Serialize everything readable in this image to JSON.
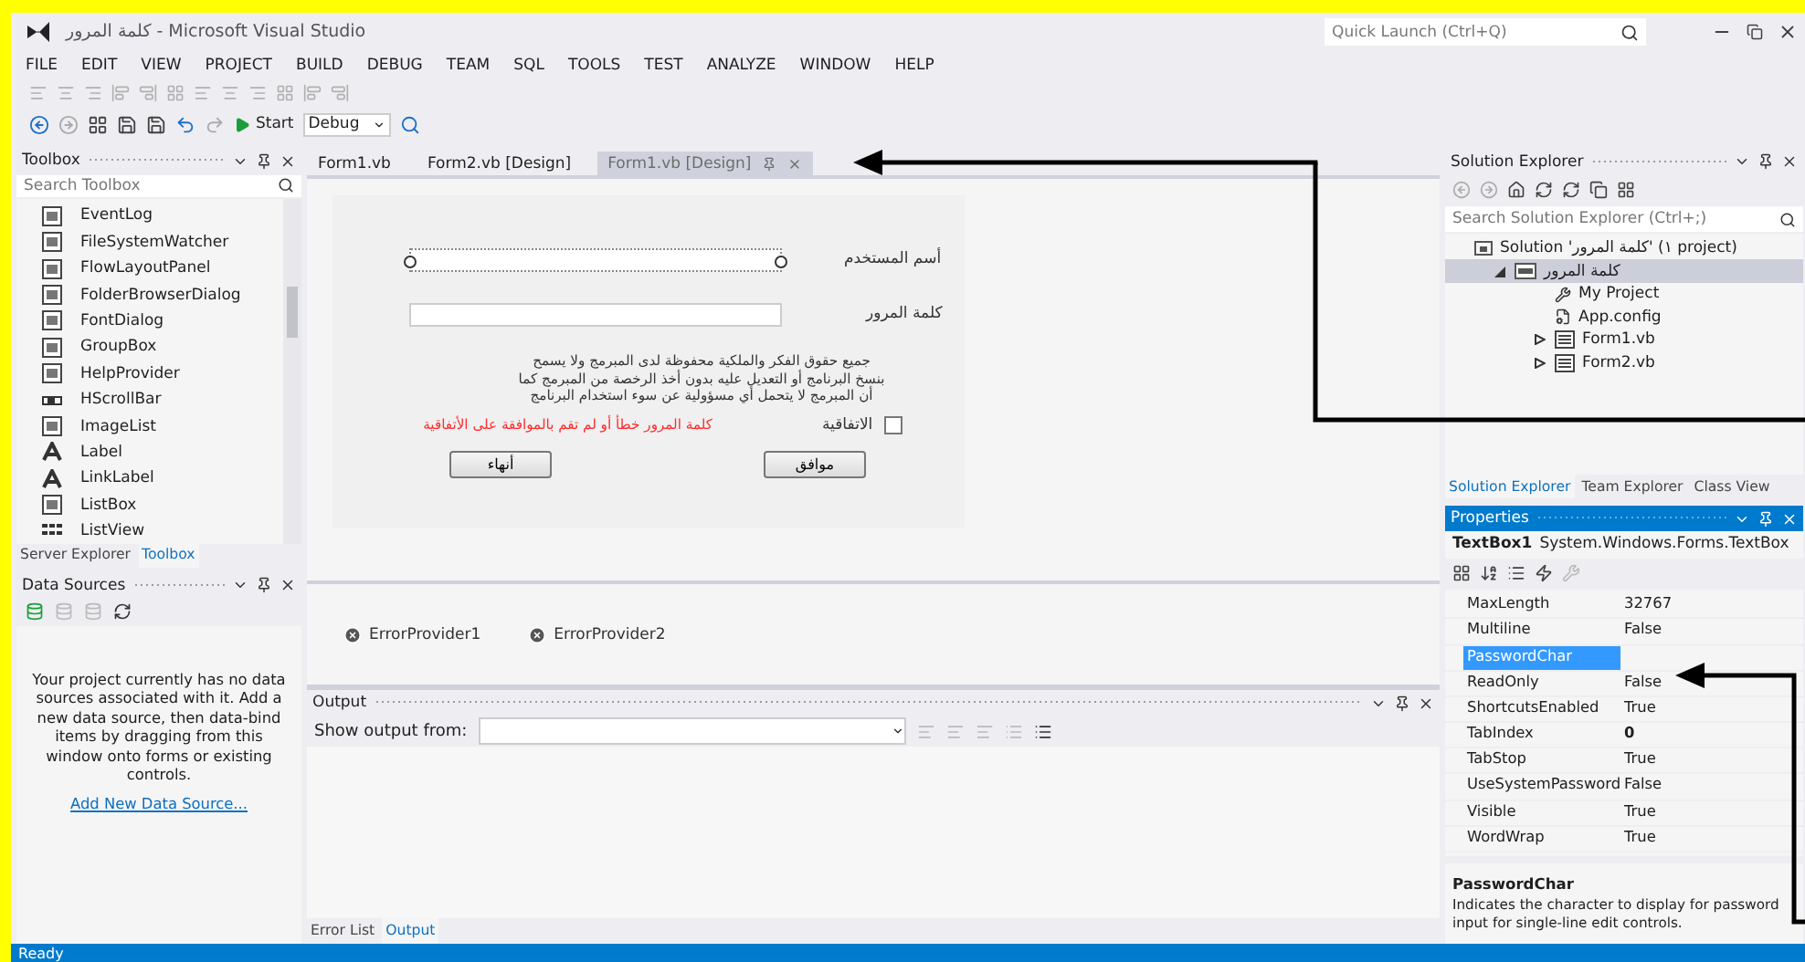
{
  "window": {
    "title": "كلمة المرور - Microsoft Visual Studio",
    "quick_launch_placeholder": "Quick Launch (Ctrl+Q)"
  },
  "menu": [
    "FILE",
    "EDIT",
    "VIEW",
    "PROJECT",
    "BUILD",
    "DEBUG",
    "TEAM",
    "SQL",
    "TOOLS",
    "TEST",
    "ANALYZE",
    "WINDOW",
    "HELP"
  ],
  "toolbar": {
    "start": "Start",
    "configuration": "Debug"
  },
  "toolbox": {
    "title": "Toolbox",
    "search_placeholder": "Search Toolbox",
    "items": [
      {
        "label": "EventLog",
        "kind": "box"
      },
      {
        "label": "FileSystemWatcher",
        "kind": "box"
      },
      {
        "label": "FlowLayoutPanel",
        "kind": "box"
      },
      {
        "label": "FolderBrowserDialog",
        "kind": "box"
      },
      {
        "label": "FontDialog",
        "kind": "box"
      },
      {
        "label": "GroupBox",
        "kind": "box"
      },
      {
        "label": "HelpProvider",
        "kind": "box"
      },
      {
        "label": "HScrollBar",
        "kind": "bar"
      },
      {
        "label": "ImageList",
        "kind": "box"
      },
      {
        "label": "Label",
        "kind": "letter"
      },
      {
        "label": "LinkLabel",
        "kind": "letter"
      },
      {
        "label": "ListBox",
        "kind": "box"
      },
      {
        "label": "ListView",
        "kind": "dots"
      }
    ],
    "tabs": [
      {
        "label": "Server Explorer",
        "selected": false
      },
      {
        "label": "Toolbox",
        "selected": true
      }
    ]
  },
  "data_sources": {
    "title": "Data Sources",
    "message": "Your project currently has no data sources associated with it. Add a new data source, then data-bind items by dragging from this window onto forms or existing controls.",
    "link": "Add New Data Source..."
  },
  "editor_tabs": [
    {
      "label": "Form1.vb",
      "selected": false
    },
    {
      "label": "Form2.vb [Design]",
      "selected": false
    },
    {
      "label": "Form1.vb [Design]",
      "selected": true
    }
  ],
  "form": {
    "username_label": "أسم المستخدم",
    "password_label": "كلمة المرور",
    "notice": "جميع حقوق الفكر والملكية محفوظة لدى المبرمج ولا يسمح\nبنسخ البرنامج أو التعديل عليه بدون أخذ الرخصة من المبرمج كما\nأن المبرمج لا يتحمل أي مسؤولية عن سوء استخدام البرنامج",
    "agree_label": "الاتفاقية",
    "agree_checked": false,
    "error": "كلمة المرور خطأ أو لم تقم بالموافقة على الأتفاقية",
    "ok_button": "موافق",
    "exit_button": "أنهاء"
  },
  "components": [
    "ErrorProvider1",
    "ErrorProvider2"
  ],
  "output": {
    "title": "Output",
    "show_from": "Show output from:",
    "tabs": [
      {
        "label": "Error List",
        "selected": false
      },
      {
        "label": "Output",
        "selected": true
      }
    ]
  },
  "solution_explorer": {
    "title": "Solution Explorer",
    "search_placeholder": "Search Solution Explorer (Ctrl+;)",
    "tree": [
      {
        "label": "Solution 'كلمة المرور' (١ project)",
        "kind": "solution",
        "selected": false,
        "children": [
          {
            "label": "كلمة المرور",
            "kind": "project",
            "selected": true,
            "expanded": true,
            "children": [
              {
                "label": "My Project",
                "kind": "wrench",
                "selected": false
              },
              {
                "label": "App.config",
                "kind": "config",
                "selected": false
              },
              {
                "label": "Form1.vb",
                "kind": "form",
                "selected": false,
                "expanded": false
              },
              {
                "label": "Form2.vb",
                "kind": "form",
                "selected": false,
                "expanded": false
              }
            ]
          }
        ]
      }
    ],
    "tabs": [
      {
        "label": "Solution Explorer",
        "selected": true
      },
      {
        "label": "Team Explorer",
        "selected": false
      },
      {
        "label": "Class View",
        "selected": false
      }
    ]
  },
  "properties": {
    "title": "Properties",
    "object": "TextBox1",
    "type": "System.Windows.Forms.TextBox",
    "rows": [
      {
        "name": "MaxLength",
        "value": "32767",
        "selected": false
      },
      {
        "name": "Multiline",
        "value": "False",
        "selected": false
      },
      {
        "name": "PasswordChar",
        "value": "",
        "selected": true
      },
      {
        "name": "ReadOnly",
        "value": "False",
        "selected": false
      },
      {
        "name": "ShortcutsEnabled",
        "value": "True",
        "selected": false
      },
      {
        "name": "TabIndex",
        "value": "0",
        "selected": false
      },
      {
        "name": "TabStop",
        "value": "True",
        "selected": false
      },
      {
        "name": "UseSystemPassword",
        "value": "False",
        "selected": false
      },
      {
        "name": "Visible",
        "value": "True",
        "selected": false
      },
      {
        "name": "WordWrap",
        "value": "True",
        "selected": false
      }
    ],
    "description_title": "PasswordChar",
    "description": "Indicates the character to display for password\ninput for single-line edit controls."
  },
  "status": "Ready"
}
